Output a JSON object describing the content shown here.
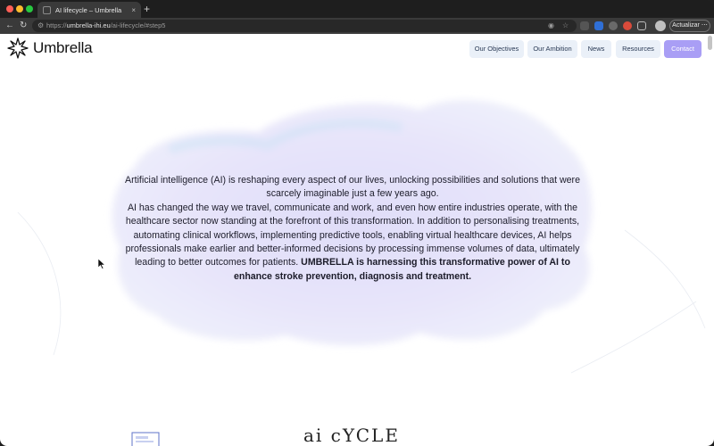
{
  "browser": {
    "tab_title": "AI lifecycle – Umbrella",
    "url_domain": "umbrella-ihi.eu",
    "url_path": "/ai-lifecycle/#step5",
    "url_scheme": "https://",
    "update_label": "Actualizar",
    "new_tab_label": "+",
    "close_tab_label": "×"
  },
  "site": {
    "logo_text": "Umbrella",
    "nav": [
      {
        "label": "Our Objectives"
      },
      {
        "label": "Our Ambition"
      },
      {
        "label": "News"
      },
      {
        "label": "Resources"
      },
      {
        "label": "Contact"
      }
    ]
  },
  "content": {
    "intro_p1": "Artificial intelligence (AI) is reshaping every aspect of our lives, unlocking possibilities and solutions that were scarcely imaginable just a few years ago.",
    "intro_p2": "AI has changed the way we travel, communicate and work, and even how entire industries operate, with the healthcare sector now standing at the forefront of this transformation. In addition to personalising treatments, automating clinical workflows, implementing predictive tools, enabling virtual healthcare devices, AI helps professionals make earlier and better-informed decisions by processing immense volumes of data, ultimately leading to better outcomes for patients.",
    "intro_bold": "UMBRELLA is harnessing this transformative power of AI to enhance stroke prevention, diagnosis and treatment.",
    "sketch_text": "ai cYCLE"
  },
  "colors": {
    "contact_button": "#a99ef5",
    "nav_button": "#eaf0f8",
    "cloud_tint": "#d9d6f7"
  }
}
